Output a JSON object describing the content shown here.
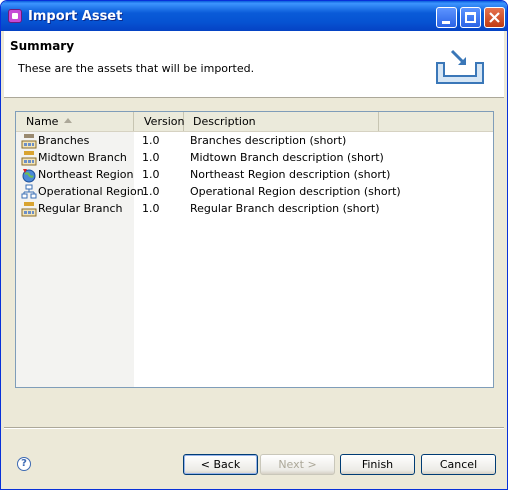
{
  "window": {
    "title": "Import Asset"
  },
  "header": {
    "title": "Summary",
    "description": "These are the assets that will be imported."
  },
  "table": {
    "columns": [
      "Name",
      "Version",
      "Description"
    ],
    "rows": [
      {
        "name": "Branches",
        "version": "1.0",
        "description": "Branches description (short)",
        "icon": "hierarchy-icon"
      },
      {
        "name": "Midtown Branch",
        "version": "1.0",
        "description": "Midtown Branch description (short)",
        "icon": "hierarchy-icon"
      },
      {
        "name": "Northeast Region",
        "version": "1.0",
        "description": "Northeast Region description (short)",
        "icon": "globe-icon"
      },
      {
        "name": "Operational Region",
        "version": "1.0",
        "description": "Operational Region description (short)",
        "icon": "org-tree-icon"
      },
      {
        "name": "Regular Branch",
        "version": "1.0",
        "description": "Regular Branch description (short)",
        "icon": "hierarchy-icon"
      }
    ]
  },
  "footer": {
    "help_symbol": "?",
    "back_label": "< Back",
    "next_label": "Next >",
    "finish_label": "Finish",
    "cancel_label": "Cancel"
  },
  "colors": {
    "titlebar": "#0653d2",
    "dialog_bg": "#ece9d8",
    "button_border": "#003c74",
    "disabled_text": "#aca899"
  }
}
